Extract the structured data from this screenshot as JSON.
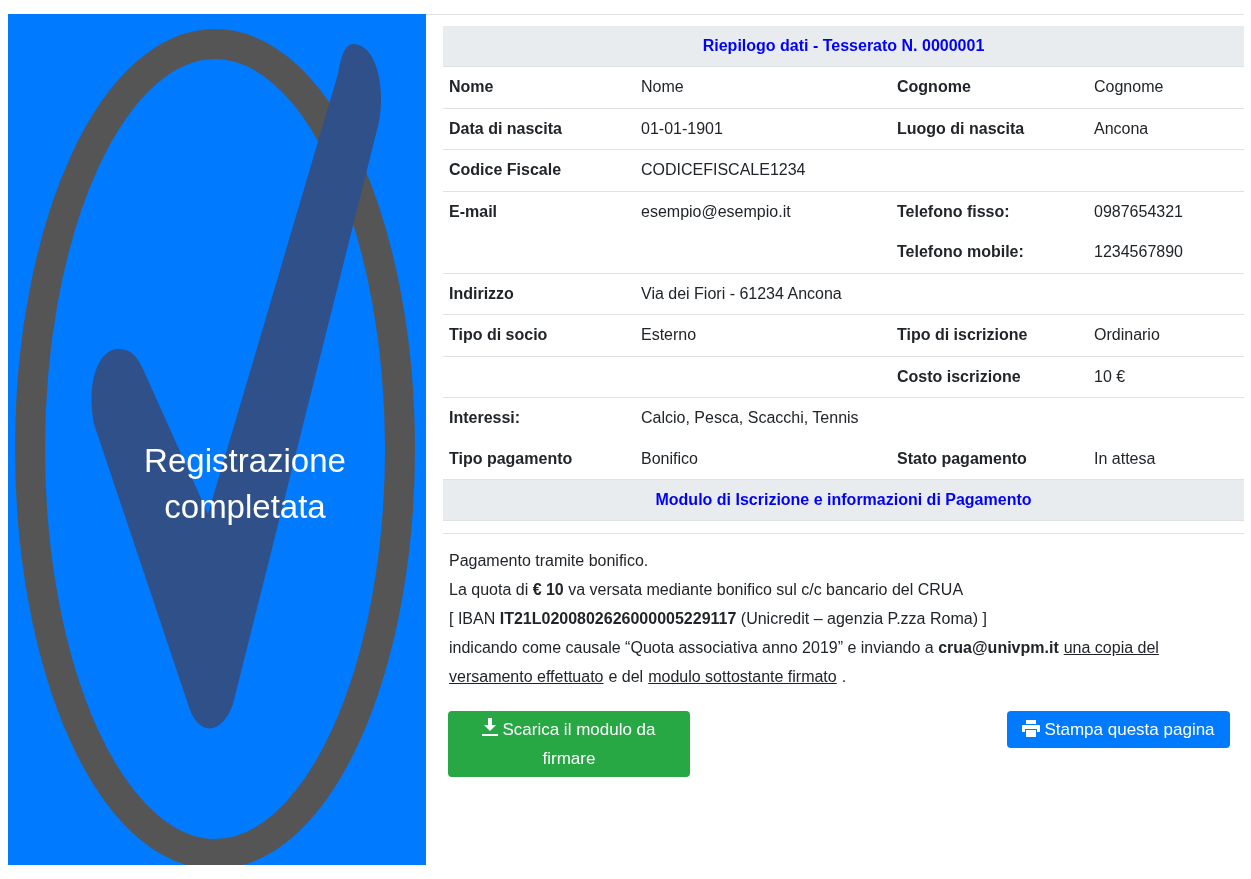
{
  "banner": {
    "message": "Registrazione completata"
  },
  "summary": {
    "title": "Riepilogo dati - Tesserato N. 0000001",
    "groups": [
      {
        "lines": [
          {
            "label": "Nome",
            "value": "Nome",
            "label_2": "Cognome",
            "value_2": "Cognome"
          }
        ]
      },
      {
        "lines": [
          {
            "label": "Data di nascita",
            "value": "01-01-1901",
            "label_2": "Luogo di nascita",
            "value_2": "Ancona"
          }
        ]
      },
      {
        "lines": [
          {
            "label": "Codice Fiscale",
            "value": "CODICEFISCALE1234"
          }
        ]
      },
      {
        "lines": [
          {
            "label": "E-mail",
            "value": "esempio@esempio.it",
            "label_2": "Telefono fisso:",
            "value_2": "0987654321"
          },
          {
            "label_2": "Telefono mobile:",
            "value_2": "1234567890"
          }
        ]
      },
      {
        "lines": [
          {
            "label": "Indirizzo",
            "value": "Via dei Fiori - 61234 Ancona"
          }
        ]
      },
      {
        "lines": [
          {
            "label": "Tipo di socio",
            "value": "Esterno",
            "label_2": "Tipo di iscrizione",
            "value_2": "Ordinario"
          }
        ]
      },
      {
        "lines": [
          {
            "label_2": "Costo iscrizione",
            "value_2": "10 €"
          }
        ]
      },
      {
        "lines": [
          {
            "label": "Interessi:",
            "value": "Calcio, Pesca, Scacchi, Tennis"
          },
          {
            "label": "Tipo pagamento",
            "value": "Bonifico",
            "label_2": "Stato pagamento",
            "value_2": "In attesa"
          }
        ]
      }
    ],
    "section_title": "Modulo di Iscrizione e informazioni di Pagamento"
  },
  "payment_info": {
    "lines": [
      [
        {
          "kind": "text",
          "text": "Pagamento tramite bonifico."
        }
      ],
      [
        {
          "kind": "text",
          "text": "La quota di **€ 10** va versata mediante bonifico sul c/c bancario del CRUA"
        }
      ],
      [
        {
          "kind": "text",
          "text": "[ IBAN **IT21L0200802626000005229117** (Unicredit – agenzia P.zza Roma) ]"
        }
      ],
      [
        {
          "kind": "text",
          "text": "indicando come causale “Quota associativa anno 2019” e inviando a **crua@univpm.it**"
        },
        {
          "kind": "link",
          "text": "una copia del"
        }
      ],
      [
        {
          "kind": "link",
          "text": "versamento effettuato"
        },
        {
          "kind": "text",
          "text": "e del"
        },
        {
          "kind": "link",
          "text": "modulo sottostante firmato"
        },
        {
          "kind": "text",
          "text": "."
        }
      ]
    ]
  },
  "buttons": [
    {
      "kind": "download",
      "label": "Scarica il modulo da firmare"
    },
    {
      "kind": "print",
      "label": "Stampa questa pagina"
    }
  ]
}
